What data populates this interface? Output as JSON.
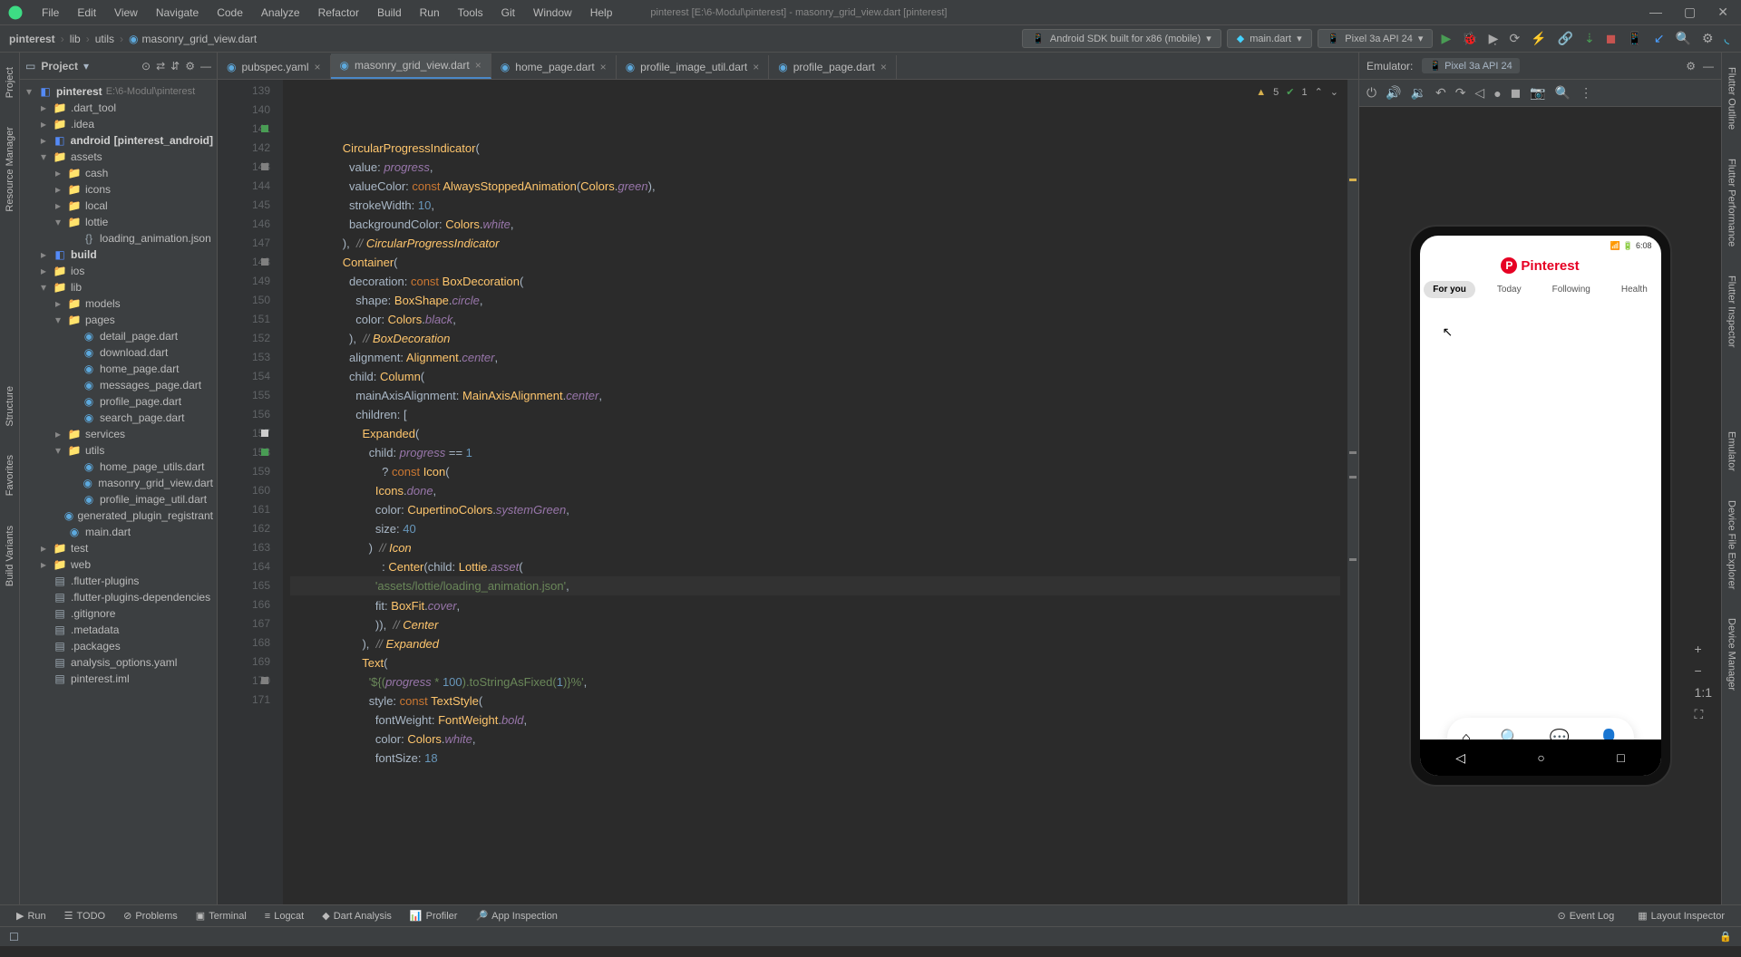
{
  "menubar": {
    "items": [
      "File",
      "Edit",
      "View",
      "Navigate",
      "Code",
      "Analyze",
      "Refactor",
      "Build",
      "Run",
      "Tools",
      "Git",
      "Window",
      "Help"
    ],
    "title": "pinterest [E:\\6-Modul\\pinterest] - masonry_grid_view.dart [pinterest]"
  },
  "breadcrumb": {
    "parts": [
      "pinterest",
      "lib",
      "utils",
      "masonry_grid_view.dart"
    ]
  },
  "toolbar": {
    "device": "Android SDK built for x86 (mobile)",
    "config": "main.dart",
    "emulator_device": "Pixel 3a API 24"
  },
  "left_sidebar": {
    "tabs": [
      "Project",
      "Resource Manager",
      "Structure",
      "Favorites",
      "Build Variants"
    ]
  },
  "right_sidebar": {
    "tabs": [
      "Flutter Outline",
      "Flutter Performance",
      "Flutter Inspector",
      "Emulator",
      "Device File Explorer",
      "Device Manager"
    ]
  },
  "project_panel": {
    "title": "Project",
    "root": {
      "name": "pinterest",
      "path": "E:\\6-Modul\\pinterest"
    },
    "tree": [
      {
        "indent": 1,
        "icon": "folder",
        "name": ".dart_tool",
        "arrow": ">"
      },
      {
        "indent": 1,
        "icon": "folder",
        "name": ".idea",
        "arrow": ">"
      },
      {
        "indent": 1,
        "icon": "pkg",
        "name": "android",
        "suffix": "[pinterest_android]",
        "arrow": ">",
        "bold": true
      },
      {
        "indent": 1,
        "icon": "folder",
        "name": "assets",
        "arrow": "v"
      },
      {
        "indent": 2,
        "icon": "folder",
        "name": "cash",
        "arrow": ">"
      },
      {
        "indent": 2,
        "icon": "folder",
        "name": "icons",
        "arrow": ">"
      },
      {
        "indent": 2,
        "icon": "folder",
        "name": "local",
        "arrow": ">"
      },
      {
        "indent": 2,
        "icon": "folder",
        "name": "lottie",
        "arrow": "v"
      },
      {
        "indent": 3,
        "icon": "json",
        "name": "loading_animation.json"
      },
      {
        "indent": 1,
        "icon": "pkg",
        "name": "build",
        "arrow": ">",
        "bold": true
      },
      {
        "indent": 1,
        "icon": "folder",
        "name": "ios",
        "arrow": ">"
      },
      {
        "indent": 1,
        "icon": "folder",
        "name": "lib",
        "arrow": "v"
      },
      {
        "indent": 2,
        "icon": "folder",
        "name": "models",
        "arrow": ">"
      },
      {
        "indent": 2,
        "icon": "folder",
        "name": "pages",
        "arrow": "v"
      },
      {
        "indent": 3,
        "icon": "dart",
        "name": "detail_page.dart"
      },
      {
        "indent": 3,
        "icon": "dart",
        "name": "download.dart"
      },
      {
        "indent": 3,
        "icon": "dart",
        "name": "home_page.dart"
      },
      {
        "indent": 3,
        "icon": "dart",
        "name": "messages_page.dart"
      },
      {
        "indent": 3,
        "icon": "dart",
        "name": "profile_page.dart"
      },
      {
        "indent": 3,
        "icon": "dart",
        "name": "search_page.dart"
      },
      {
        "indent": 2,
        "icon": "folder",
        "name": "services",
        "arrow": ">"
      },
      {
        "indent": 2,
        "icon": "folder",
        "name": "utils",
        "arrow": "v"
      },
      {
        "indent": 3,
        "icon": "dart",
        "name": "home_page_utils.dart"
      },
      {
        "indent": 3,
        "icon": "dart",
        "name": "masonry_grid_view.dart"
      },
      {
        "indent": 3,
        "icon": "dart",
        "name": "profile_image_util.dart"
      },
      {
        "indent": 2,
        "icon": "dart",
        "name": "generated_plugin_registrant"
      },
      {
        "indent": 2,
        "icon": "dart",
        "name": "main.dart"
      },
      {
        "indent": 1,
        "icon": "folder",
        "name": "test",
        "arrow": ">"
      },
      {
        "indent": 1,
        "icon": "folder",
        "name": "web",
        "arrow": ">"
      },
      {
        "indent": 1,
        "icon": "file",
        "name": ".flutter-plugins"
      },
      {
        "indent": 1,
        "icon": "file",
        "name": ".flutter-plugins-dependencies"
      },
      {
        "indent": 1,
        "icon": "file",
        "name": ".gitignore"
      },
      {
        "indent": 1,
        "icon": "file",
        "name": ".metadata"
      },
      {
        "indent": 1,
        "icon": "file",
        "name": ".packages"
      },
      {
        "indent": 1,
        "icon": "file",
        "name": "analysis_options.yaml"
      },
      {
        "indent": 1,
        "icon": "file",
        "name": "pinterest.iml"
      }
    ]
  },
  "editor": {
    "tabs": [
      {
        "name": "pubspec.yaml",
        "icon": "yaml"
      },
      {
        "name": "masonry_grid_view.dart",
        "icon": "dart",
        "active": true
      },
      {
        "name": "home_page.dart",
        "icon": "dart"
      },
      {
        "name": "profile_image_util.dart",
        "icon": "dart"
      },
      {
        "name": "profile_page.dart",
        "icon": "dart"
      }
    ],
    "indicators": {
      "warnings": "5",
      "ok": "1"
    },
    "first_line": 139,
    "lines": [
      "                CircularProgressIndicator(",
      "                  value: progress,",
      "                  valueColor: const AlwaysStoppedAnimation(Colors.green),",
      "                  strokeWidth: 10,",
      "                  backgroundColor: Colors.white,",
      "                ),  // CircularProgressIndicator",
      "                Container(",
      "                  decoration: const BoxDecoration(",
      "                    shape: BoxShape.circle,",
      "                    color: Colors.black,",
      "                  ),  // BoxDecoration",
      "                  alignment: Alignment.center,",
      "                  child: Column(",
      "                    mainAxisAlignment: MainAxisAlignment.center,",
      "                    children: [",
      "                      Expanded(",
      "                        child: progress == 1",
      "                            ? const Icon(",
      "                          Icons.done,",
      "                          color: CupertinoColors.systemGreen,",
      "                          size: 40",
      "                        )  // Icon",
      "                            : Center(child: Lottie.asset(",
      "                          'assets/lottie/loading_animation.json',",
      "                          fit: BoxFit.cover,",
      "                          )),  // Center",
      "                      ),  // Expanded",
      "                      Text(",
      "                        '${(progress * 100).toStringAsFixed(1)}%',",
      "                        style: const TextStyle(",
      "                          fontWeight: FontWeight.bold,",
      "                          color: Colors.white,",
      "                          fontSize: 18"
    ],
    "gutter_marks": {
      "141": "green",
      "143": "gray",
      "148": "gray",
      "157": "white",
      "158": "green",
      "170": "gray"
    }
  },
  "emulator": {
    "title": "Emulator:",
    "device": "Pixel 3a API 24",
    "time": "6:08",
    "app_title": "Pinterest",
    "tabs": [
      "For you",
      "Today",
      "Following",
      "Health"
    ]
  },
  "bottom_tabs": [
    "Run",
    "TODO",
    "Problems",
    "Terminal",
    "Logcat",
    "Dart Analysis",
    "Profiler",
    "App Inspection"
  ],
  "bottom_right": [
    "Event Log",
    "Layout Inspector"
  ],
  "statusbar": {
    "ratio": "1:1",
    "lock": "🔒"
  }
}
